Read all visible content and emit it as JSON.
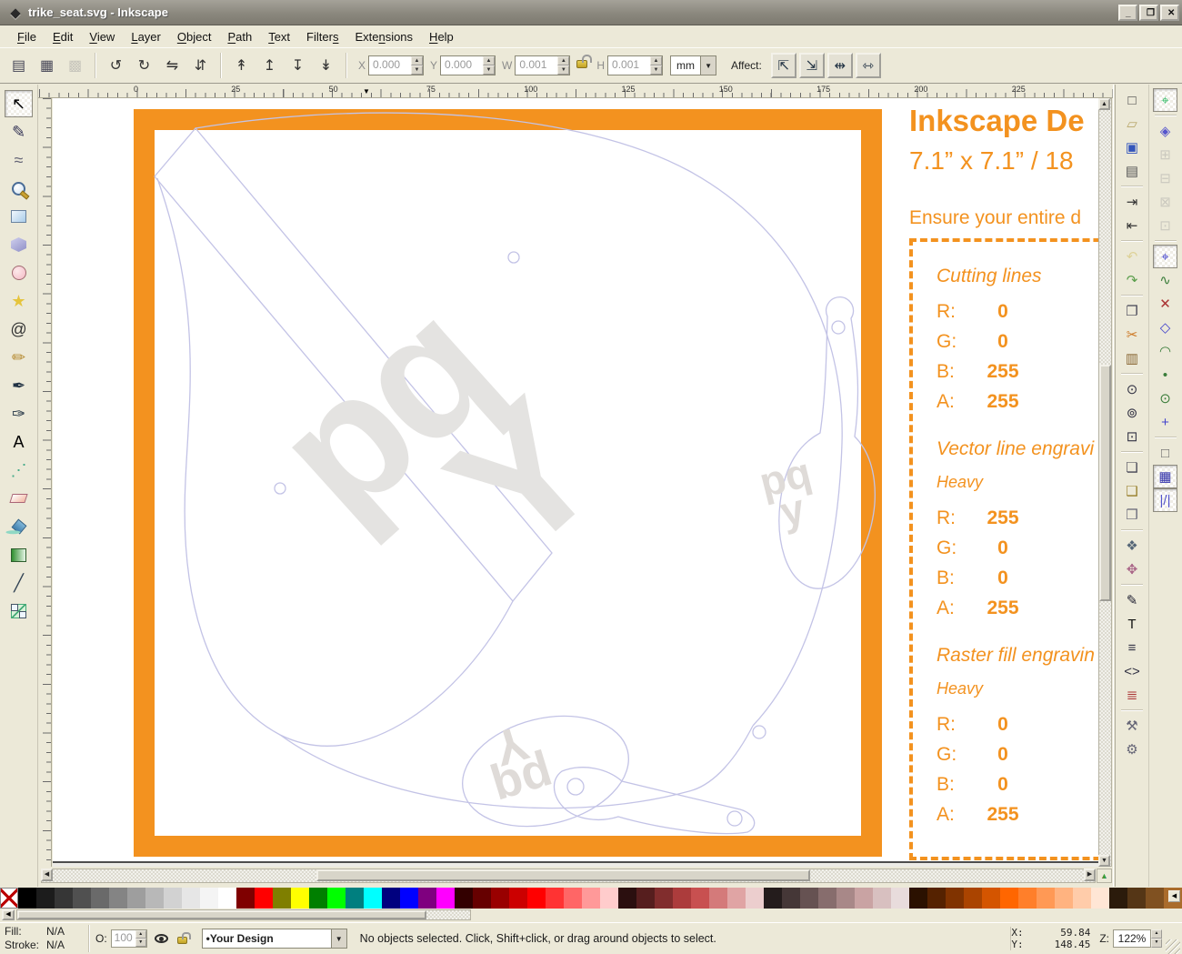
{
  "window": {
    "title": "trike_seat.svg - Inkscape",
    "icon_glyph": "◆",
    "controls": [
      {
        "name": "minimize-button",
        "glyph": "_"
      },
      {
        "name": "maximize-button",
        "glyph": "❐"
      },
      {
        "name": "close-button",
        "glyph": "✕"
      }
    ]
  },
  "menu": {
    "items": [
      {
        "label": "File",
        "underline": 0
      },
      {
        "label": "Edit",
        "underline": 0
      },
      {
        "label": "View",
        "underline": 0
      },
      {
        "label": "Layer",
        "underline": 0
      },
      {
        "label": "Object",
        "underline": 0
      },
      {
        "label": "Path",
        "underline": 0
      },
      {
        "label": "Text",
        "underline": 0
      },
      {
        "label": "Filters",
        "underline": 6
      },
      {
        "label": "Extensions",
        "underline": 4
      },
      {
        "label": "Help",
        "underline": 0
      }
    ]
  },
  "select_toolbar": {
    "buttons": [
      {
        "name": "select-all-button",
        "glyph": "▤",
        "color": "#445"
      },
      {
        "name": "select-all-layers-button",
        "glyph": "▦",
        "color": "#445"
      },
      {
        "name": "deselect-button",
        "glyph": "▩",
        "color": "#999",
        "dis": true,
        "sep": true
      },
      {
        "name": "rotate-ccw-button",
        "glyph": "↺",
        "color": "#333"
      },
      {
        "name": "rotate-cw-button",
        "glyph": "↻",
        "color": "#333"
      },
      {
        "name": "flip-horizontal-button",
        "glyph": "⇋",
        "color": "#333"
      },
      {
        "name": "flip-vertical-button",
        "glyph": "⇵",
        "color": "#333",
        "sep": true
      },
      {
        "name": "raise-to-top-button",
        "glyph": "↟",
        "color": "#333"
      },
      {
        "name": "raise-button",
        "glyph": "↥",
        "color": "#333"
      },
      {
        "name": "lower-button",
        "glyph": "↧",
        "color": "#333"
      },
      {
        "name": "lower-to-bottom-button",
        "glyph": "↡",
        "color": "#333",
        "sep": true
      }
    ],
    "fields": [
      {
        "name": "x-field",
        "label": "X",
        "value": "0.000"
      },
      {
        "name": "y-field",
        "label": "Y",
        "value": "0.000"
      },
      {
        "name": "w-field",
        "label": "W",
        "value": "0.001",
        "lock_after": true
      },
      {
        "name": "h-field",
        "label": "H",
        "value": "0.001"
      }
    ],
    "unit": "mm",
    "affect_label": "Affect:",
    "affect_buttons": [
      {
        "name": "affect-move-button",
        "glyph": "⇱"
      },
      {
        "name": "affect-transform-button",
        "glyph": "⇲"
      },
      {
        "name": "affect-corners-button",
        "glyph": "⇹"
      },
      {
        "name": "affect-patterns-button",
        "glyph": "⇿"
      }
    ]
  },
  "ruler": {
    "labels": [
      "0",
      "25",
      "50",
      "75",
      "100",
      "125",
      "150",
      "175",
      "200",
      "225"
    ]
  },
  "toolbox": {
    "tools": [
      {
        "name": "selector-tool",
        "glyph": "↖",
        "color": "#000",
        "active": true
      },
      {
        "name": "node-tool",
        "glyph": "✎",
        "color": "#335"
      },
      {
        "name": "tweak-tool",
        "glyph": "≈",
        "color": "#667"
      },
      {
        "name": "zoom-tool",
        "kind": "zoom"
      },
      {
        "name": "rectangle-tool",
        "kind": "rect"
      },
      {
        "name": "box3d-tool",
        "kind": "box3d"
      },
      {
        "name": "ellipse-tool",
        "kind": "ellipse"
      },
      {
        "name": "star-tool",
        "glyph": "★",
        "color": "#e5c43c"
      },
      {
        "name": "spiral-tool",
        "glyph": "@",
        "color": "#333"
      },
      {
        "name": "pencil-tool",
        "glyph": "✏",
        "color": "#b5892f"
      },
      {
        "name": "pen-tool",
        "glyph": "✒",
        "color": "#234"
      },
      {
        "name": "calligraphy-tool",
        "glyph": "✑",
        "color": "#234"
      },
      {
        "name": "text-tool",
        "glyph": "A",
        "color": "#000"
      },
      {
        "name": "spray-tool",
        "glyph": "⋰",
        "color": "#4a8"
      },
      {
        "name": "eraser-tool",
        "kind": "eraser"
      },
      {
        "name": "bucket-tool",
        "kind": "bucket"
      },
      {
        "name": "gradient-tool",
        "kind": "gradient"
      },
      {
        "name": "dropper-tool",
        "glyph": "╱",
        "color": "#345"
      },
      {
        "name": "connector-tool",
        "kind": "connector"
      }
    ]
  },
  "commands": {
    "buttons": [
      {
        "name": "new-document-button",
        "glyph": "□",
        "color": "#444"
      },
      {
        "name": "open-document-button",
        "glyph": "▱",
        "color": "#b8a66a"
      },
      {
        "name": "save-button",
        "glyph": "▣",
        "color": "#3355bb"
      },
      {
        "name": "print-button",
        "glyph": "▤",
        "color": "#555",
        "sep": true
      },
      {
        "name": "import-button",
        "glyph": "⇥",
        "color": "#333"
      },
      {
        "name": "export-button",
        "glyph": "⇤",
        "color": "#333",
        "sep": true
      },
      {
        "name": "undo-button",
        "glyph": "↶",
        "color": "#c9b037",
        "dis": true
      },
      {
        "name": "redo-button",
        "glyph": "↷",
        "color": "#5a9e4b",
        "sep": true
      },
      {
        "name": "copy-button",
        "glyph": "❐",
        "color": "#445"
      },
      {
        "name": "cut-button",
        "glyph": "✂",
        "color": "#cc7722"
      },
      {
        "name": "paste-button",
        "glyph": "▥",
        "color": "#886633",
        "sep": true
      },
      {
        "name": "zoom-selection-button",
        "glyph": "⊙",
        "color": "#334"
      },
      {
        "name": "zoom-drawing-button",
        "glyph": "⊚",
        "color": "#334"
      },
      {
        "name": "zoom-page-button",
        "glyph": "⊡",
        "color": "#334",
        "sep": true
      },
      {
        "name": "duplicate-button",
        "glyph": "❏",
        "color": "#445"
      },
      {
        "name": "clone-button",
        "glyph": "❑",
        "color": "#967d28"
      },
      {
        "name": "unlink-clone-button",
        "glyph": "❒",
        "color": "#667",
        "sep": true
      },
      {
        "name": "group-button",
        "glyph": "❖",
        "color": "#567"
      },
      {
        "name": "ungroup-button",
        "glyph": "✥",
        "color": "#a68",
        "sep": true
      },
      {
        "name": "fill-stroke-button",
        "glyph": "✎",
        "color": "#223"
      },
      {
        "name": "text-dialog-button",
        "glyph": "T",
        "color": "#111"
      },
      {
        "name": "layers-dialog-button",
        "glyph": "≡",
        "color": "#334"
      },
      {
        "name": "xml-editor-button",
        "glyph": "<>",
        "color": "#334"
      },
      {
        "name": "align-dialog-button",
        "glyph": "≣",
        "color": "#a33",
        "sep": true
      },
      {
        "name": "preferences-button",
        "glyph": "⚒",
        "color": "#667"
      },
      {
        "name": "document-properties-button",
        "glyph": "⚙",
        "color": "#667"
      }
    ]
  },
  "snap": {
    "buttons": [
      {
        "name": "snap-toggle-button",
        "glyph": "⌖",
        "color": "#3b6",
        "active": true,
        "sep": true
      },
      {
        "name": "snap-bbox-button",
        "glyph": "◈",
        "color": "#55c"
      },
      {
        "name": "snap-bbox-edges-button",
        "glyph": "⊞",
        "color": "#999",
        "dis": true
      },
      {
        "name": "snap-bbox-corners-button",
        "glyph": "⊟",
        "color": "#999",
        "dis": true
      },
      {
        "name": "snap-bbox-edge-midpoints-button",
        "glyph": "⊠",
        "color": "#999",
        "dis": true
      },
      {
        "name": "snap-bbox-centers-button",
        "glyph": "⊡",
        "color": "#999",
        "dis": true,
        "sep": true
      },
      {
        "name": "snap-nodes-button",
        "glyph": "⌖",
        "color": "#44c",
        "active": true
      },
      {
        "name": "snap-paths-button",
        "glyph": "∿",
        "color": "#3a7d3a"
      },
      {
        "name": "snap-path-intersections-button",
        "glyph": "✕",
        "color": "#a33"
      },
      {
        "name": "snap-cusp-nodes-button",
        "glyph": "◇",
        "color": "#44c"
      },
      {
        "name": "snap-smooth-nodes-button",
        "glyph": "◠",
        "color": "#3a7d3a"
      },
      {
        "name": "snap-midpoints-button",
        "glyph": "•",
        "color": "#3a7d3a"
      },
      {
        "name": "snap-object-centers-button",
        "glyph": "⊙",
        "color": "#3a7d3a"
      },
      {
        "name": "snap-rotation-center-button",
        "glyph": "+",
        "color": "#44c",
        "sep": true
      },
      {
        "name": "snap-page-border-button",
        "glyph": "□",
        "color": "#666"
      },
      {
        "name": "snap-grid-button",
        "glyph": "▦",
        "color": "#33a",
        "active": true
      },
      {
        "name": "snap-guides-button",
        "glyph": "|/|",
        "color": "#55c",
        "active": true
      }
    ]
  },
  "canvas": {
    "accent_orange": "#F3921F",
    "outline_color": "#c3c3e6",
    "watermark_color": "#e4e3e1",
    "watermark": {
      "top": "pq",
      "bottom": "Y",
      "bottom_small": "y"
    },
    "template": {
      "title": "Inkscape De",
      "subtitle": "7.1” x 7.1” / 18",
      "note": "Ensure your entire d",
      "sections": [
        {
          "heading": "Cutting lines",
          "sub": "",
          "rows": [
            {
              "label": "R:",
              "value": "0"
            },
            {
              "label": "G:",
              "value": "0"
            },
            {
              "label": "B:",
              "value": "255"
            },
            {
              "label": "A:",
              "value": "255"
            }
          ]
        },
        {
          "heading": "Vector line engravi",
          "sub": "Heavy",
          "rows": [
            {
              "label": "R:",
              "value": "255"
            },
            {
              "label": "G:",
              "value": "0"
            },
            {
              "label": "B:",
              "value": "0"
            },
            {
              "label": "A:",
              "value": "255"
            }
          ]
        },
        {
          "heading": "Raster fill engravin",
          "sub": "Heavy",
          "rows": [
            {
              "label": "R:",
              "value": "0"
            },
            {
              "label": "G:",
              "value": "0"
            },
            {
              "label": "B:",
              "value": "0"
            },
            {
              "label": "A:",
              "value": "255"
            }
          ]
        }
      ]
    }
  },
  "palette": {
    "colors": [
      "none",
      "#000000",
      "#1c1c1c",
      "#363636",
      "#505050",
      "#6a6a6a",
      "#848484",
      "#9e9e9e",
      "#b8b8b8",
      "#d2d2d2",
      "#e6e6e6",
      "#f4f4f4",
      "#ffffff",
      "#7f0000",
      "#ff0000",
      "#7f7f00",
      "#ffff00",
      "#007f00",
      "#00ff00",
      "#007f7f",
      "#00ffff",
      "#00007f",
      "#0000ff",
      "#7f007f",
      "#ff00ff",
      "#330000",
      "#660000",
      "#990000",
      "#cc0000",
      "#ff0000",
      "#ff3333",
      "#ff6666",
      "#ff9999",
      "#ffcccc",
      "#2b0f0f",
      "#561e1e",
      "#812d2d",
      "#ac3c3c",
      "#c85050",
      "#d47a7a",
      "#e0a4a4",
      "#eccece",
      "#241c1c",
      "#453737",
      "#665252",
      "#876d6d",
      "#a88888",
      "#c9a3a3",
      "#d8c0c0",
      "#e8dcdc",
      "#2b1100",
      "#552200",
      "#803300",
      "#aa4400",
      "#d45500",
      "#ff6600",
      "#ff7f2a",
      "#ff9955",
      "#ffb380",
      "#ffccaa",
      "#ffe6d5",
      "#2b1b0b",
      "#553616",
      "#805121",
      "#aa6c2c"
    ]
  },
  "statusbar": {
    "fill_label": "Fill:",
    "fill_value": "N/A",
    "stroke_label": "Stroke:",
    "stroke_value": "N/A",
    "opacity_label": "O:",
    "opacity_value": "100",
    "layer_bullet": "•",
    "layer_name": "Your Design",
    "message": "No objects selected. Click, Shift+click, or drag around objects to select.",
    "x_label": "X:",
    "x_value": "59.84",
    "y_label": "Y:",
    "y_value": "148.45",
    "zoom_label": "Z:",
    "zoom_value": "122%"
  }
}
